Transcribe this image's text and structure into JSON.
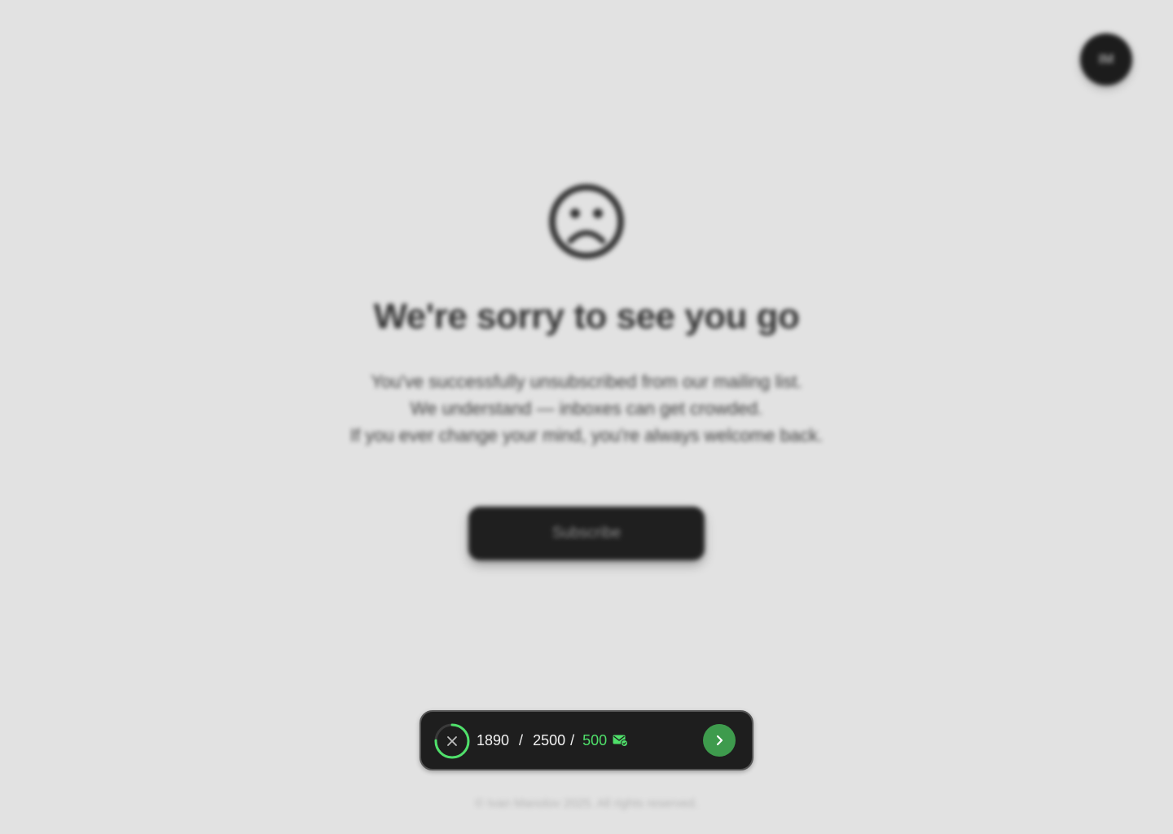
{
  "user": {
    "initials": "IM"
  },
  "unsubscribe": {
    "headline": "We're sorry to see you go",
    "lines": [
      "You've successfully unsubscribed from our mailing list.",
      "We understand — inboxes can get crowded.",
      "If you ever change your mind, you're always welcome back."
    ],
    "subscribe_label": "Subscribe",
    "face_icon": "sad-face-icon"
  },
  "footer": {
    "copyright": "© Ivan Manolov 2025. All rights reserved."
  },
  "quota_widget": {
    "used": "1890",
    "separator": "/",
    "total": "2500",
    "bonus": "500",
    "progress_fraction": 0.756,
    "accent_color": "#4fe06a",
    "button_color": "#3e9b4d",
    "icons": [
      "close-icon",
      "mail-check-icon",
      "chevron-right-icon"
    ]
  }
}
